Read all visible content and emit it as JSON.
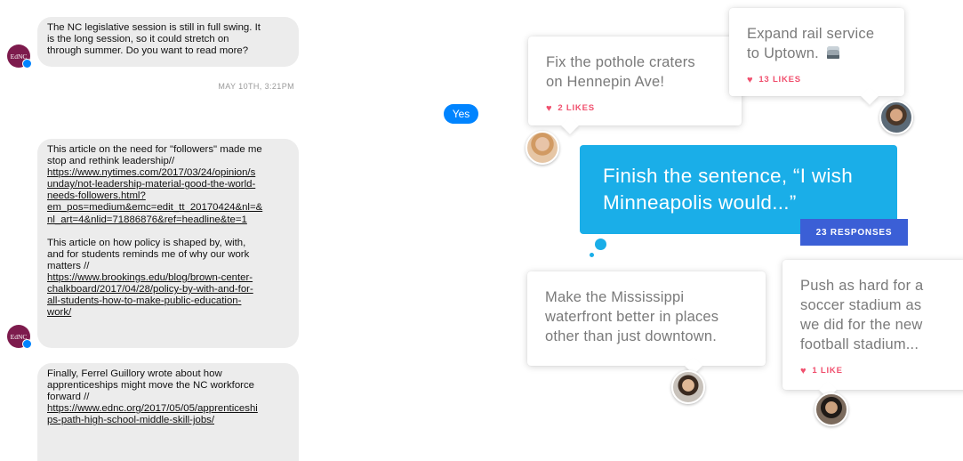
{
  "messenger": {
    "avatar_text": "EdNC",
    "messages": [
      {
        "lines": [
          "The NC legislative session is still in full swing. It",
          "is the long session, so it could stretch on",
          "through summer. Do you want to read more?"
        ]
      },
      {
        "para1_lines": [
          "This article on the need for \"followers\" made me",
          "stop and rethink leadership//"
        ],
        "link1_lines": [
          "https://www.nytimes.com/2017/03/24/opinion/s",
          "unday/not-leadership-material-good-the-world-",
          "needs-followers.html?",
          "em_pos=medium&emc=edit_tt_20170424&nl=&",
          "nl_art=4&nlid=71886876&ref=headline&te=1"
        ],
        "para2_lines": [
          "This article on how policy is shaped by, with,",
          "and for students reminds me of why our work",
          "matters //"
        ],
        "link2_lines": [
          "https://www.brookings.edu/blog/brown-center-",
          "chalkboard/2017/04/28/policy-by-with-and-for-",
          "all-students-how-to-make-public-education-",
          "work/"
        ]
      },
      {
        "para_lines": [
          "Finally, Ferrel Guillory wrote about how",
          "apprenticeships might move the NC workforce",
          "forward //"
        ],
        "link_lines": [
          "https://www.ednc.org/2017/05/05/apprenticeshi",
          "ps-path-high-school-middle-skill-jobs/"
        ]
      }
    ],
    "timestamp": "MAY 10TH, 3:21PM",
    "reply": "Yes"
  },
  "board": {
    "prompt_line1": "Finish the sentence, “I wish",
    "prompt_line2": "Minneapolis would...”",
    "responses_badge": "23 RESPONSES",
    "cards": [
      {
        "line1": "Fix the pothole craters",
        "line2": "on Hennepin Ave!",
        "likes": "2 LIKES"
      },
      {
        "line1": "Expand rail service",
        "line2": "to Uptown.",
        "likes": "13 LIKES"
      },
      {
        "line1": "Make the Mississippi",
        "line2": "waterfront better in places",
        "line3": "other than just downtown."
      },
      {
        "line1": "Push as hard for a",
        "line2": "soccer stadium as",
        "line3": "we did for the new",
        "line4": "football stadium...",
        "likes": "1 LIKE"
      }
    ]
  },
  "colors": {
    "brand_avatar": "#7d1b4d",
    "messenger_blue": "#0084ff",
    "prompt_blue": "#1aaee8",
    "badge_blue": "#3b5fd6",
    "like_red": "#f0506e"
  }
}
